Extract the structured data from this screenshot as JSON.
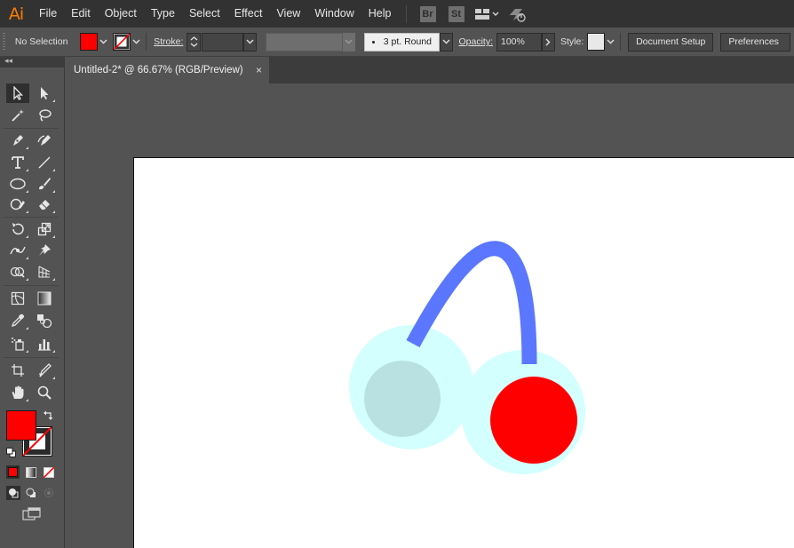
{
  "app": {
    "logo": "Ai"
  },
  "menu": {
    "items": [
      "File",
      "Edit",
      "Object",
      "Type",
      "Select",
      "Effect",
      "View",
      "Window",
      "Help"
    ],
    "badges": [
      "Br",
      "St"
    ]
  },
  "control_bar": {
    "selection_label": "No Selection",
    "stroke_label": "Stroke:",
    "brush_label": "3 pt. Round",
    "opacity_label": "Opacity:",
    "opacity_value": "100%",
    "style_label": "Style:",
    "document_setup_label": "Document Setup",
    "preferences_label": "Preferences"
  },
  "document": {
    "tab_title": "Untitled-2* @ 66.67% (RGB/Preview)",
    "close_glyph": "×"
  },
  "colors": {
    "fill": "#ff0000",
    "artboard": "#ffffff",
    "arc_stroke": "#5b76ff",
    "outer_circle": "#d3ffff",
    "left_inner_circle": "#b9e1e1",
    "right_inner_circle": "#ff0000",
    "logo": "#ff7c00"
  },
  "tools": [
    "selection-tool-icon",
    "direct-selection-tool-icon",
    "magic-wand-tool-icon",
    "lasso-tool-icon",
    "pen-tool-icon",
    "curvature-tool-icon",
    "type-tool-icon",
    "line-segment-tool-icon",
    "ellipse-tool-icon",
    "paintbrush-tool-icon",
    "shaper-tool-icon",
    "eraser-tool-icon",
    "rotate-tool-icon",
    "scale-tool-icon",
    "width-tool-icon",
    "puppet-warp-tool-icon",
    "shape-builder-tool-icon",
    "perspective-grid-tool-icon",
    "mesh-tool-icon",
    "gradient-tool-icon",
    "eyedropper-tool-icon",
    "blend-tool-icon",
    "symbol-sprayer-tool-icon",
    "column-graph-tool-icon",
    "artboard-tool-icon",
    "slice-tool-icon",
    "hand-tool-icon",
    "zoom-tool-icon"
  ]
}
